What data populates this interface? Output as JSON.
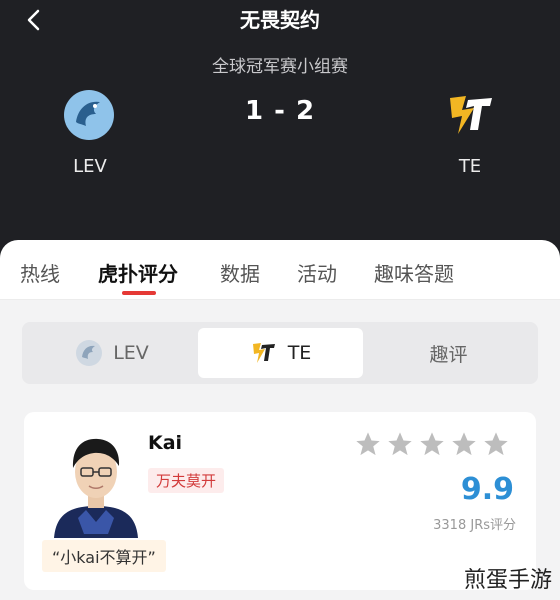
{
  "header": {
    "title": "无畏契约",
    "subtitle": "全球冠军赛小组赛",
    "score": "1 - 2",
    "home_team": {
      "name": "LEV",
      "icon": "lev-logo-icon"
    },
    "away_team": {
      "name": "TE",
      "icon": "te-logo-icon"
    }
  },
  "tabs": [
    {
      "label": "热线"
    },
    {
      "label": "虎扑评分",
      "active": true
    },
    {
      "label": "数据"
    },
    {
      "label": "活动"
    },
    {
      "label": "趣味答题"
    }
  ],
  "segments": [
    {
      "label": "LEV",
      "icon": "lev-logo-icon"
    },
    {
      "label": "TE",
      "icon": "te-logo-icon",
      "active": true
    },
    {
      "label": "趣评"
    }
  ],
  "player": {
    "name": "Kai",
    "tag": "万夫莫开",
    "stars": 5,
    "rating": "9.9",
    "votes": "3318 JRs评分",
    "quote": "“小kai不算开”"
  },
  "watermark": "煎蛋手游",
  "colors": {
    "accent": "#e53935",
    "rating": "#2d8fd5",
    "header_bg": "#1f2024"
  }
}
